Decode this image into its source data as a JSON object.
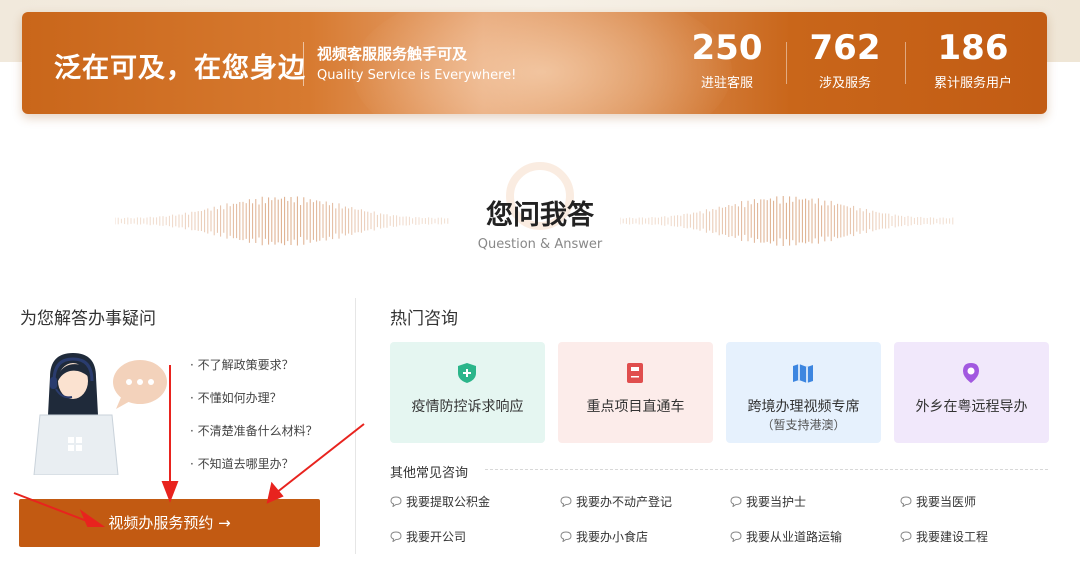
{
  "banner": {
    "slogan": "泛在可及，在您身边",
    "subtitle_cn": "视频客服服务触手可及",
    "subtitle_en": "Quality Service is Everywhere!",
    "stats": [
      {
        "value": "250",
        "label": "进驻客服"
      },
      {
        "value": "762",
        "label": "涉及服务"
      },
      {
        "value": "186",
        "label": "累计服务用户"
      }
    ]
  },
  "section": {
    "title": "您问我答",
    "subtitle": "Question & Answer"
  },
  "left": {
    "title": "为您解答办事疑问",
    "questions": [
      "· 不了解政策要求？",
      "· 不懂如何办理？",
      "· 不清楚准备什么材料？",
      "· 不知道去哪里办？"
    ],
    "book_button": "视频办服务预约 →"
  },
  "right": {
    "title": "热门咨询",
    "cards": [
      {
        "label": "疫情防控诉求响应",
        "sub": "",
        "icon": "shield-plus-icon",
        "bg": "#e5f6f1",
        "color": "#2bb58a"
      },
      {
        "label": "重点项目直通车",
        "sub": "",
        "icon": "book-icon",
        "bg": "#fcecea",
        "color": "#e04e4e"
      },
      {
        "label": "跨境办理视频专席",
        "sub": "（暂支持港澳）",
        "icon": "map-icon",
        "bg": "#e6f1fd",
        "color": "#3d86e0"
      },
      {
        "label": "外乡在粤远程导办",
        "sub": "",
        "icon": "location-pin-icon",
        "bg": "#f1e8fb",
        "color": "#a259e0"
      }
    ],
    "other_title": "其他常见咨询",
    "links": [
      "我要提取公积金",
      "我要办不动产登记",
      "我要当护士",
      "我要当医师",
      "我要开公司",
      "我要办小食店",
      "我要从业道路运输",
      "我要建设工程"
    ]
  }
}
